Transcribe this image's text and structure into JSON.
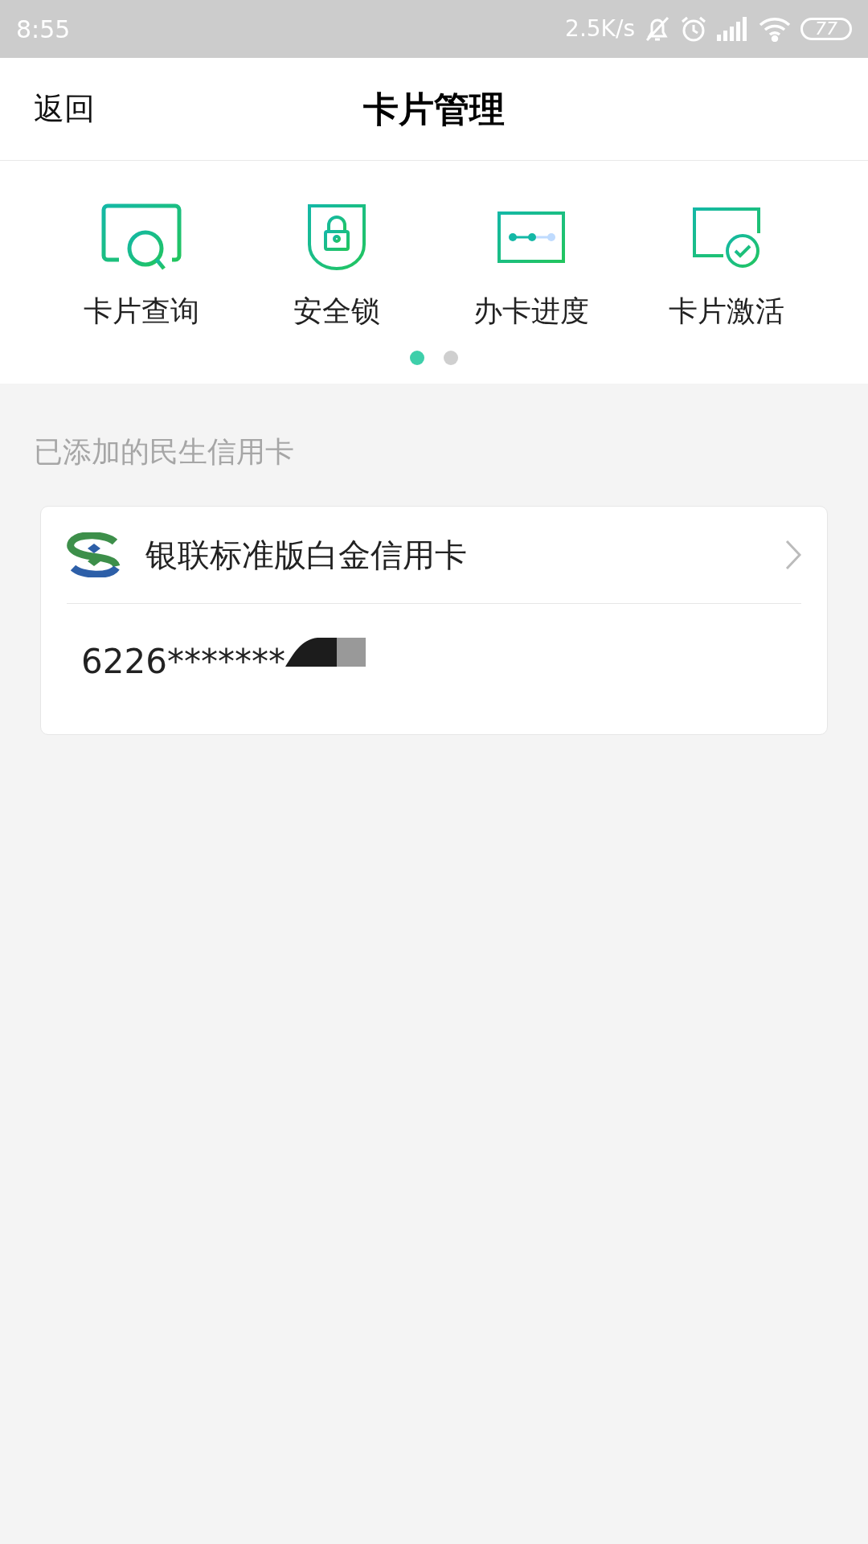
{
  "status_bar": {
    "time": "8:55",
    "net_speed": "2.5K/s",
    "battery": "77"
  },
  "header": {
    "back": "返回",
    "title": "卡片管理"
  },
  "shortcuts": [
    {
      "kind": "search",
      "label": "卡片查询"
    },
    {
      "kind": "lock",
      "label": "安全锁"
    },
    {
      "kind": "progress",
      "label": "办卡进度"
    },
    {
      "kind": "activate",
      "label": "卡片激活"
    }
  ],
  "pager": [
    {
      "selected": true
    },
    {
      "selected": false
    }
  ],
  "section_label": "已添加的民生信用卡",
  "cards": [
    {
      "name": "银联标准版白金信用卡",
      "number": "6226*******"
    }
  ]
}
